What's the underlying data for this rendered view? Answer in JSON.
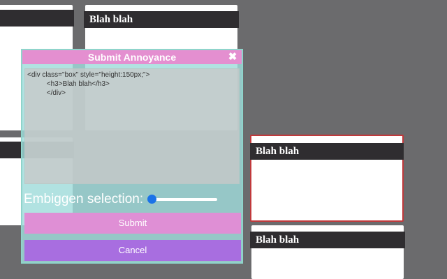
{
  "boxes": [
    {
      "title": ""
    },
    {
      "title": "Blah blah"
    },
    {
      "title": ""
    },
    {
      "title": "Blah blah"
    },
    {
      "title": "Blah blah"
    }
  ],
  "modal": {
    "title": "Submit Annoyance",
    "close_symbol": "✖",
    "code": "<div class=\"box\" style=\"height:150px;\">\n          <h3>Blah blah</h3>\n          </div>",
    "slider_label": "Embiggen selection:",
    "slider_value": 0,
    "submit_label": "Submit",
    "cancel_label": "Cancel"
  },
  "colors": {
    "titlebar": "#e48fd0",
    "submit": "#df8fd5",
    "cancel": "#a86ee0",
    "slider_thumb": "#1a73e8",
    "selected_border": "#c0393b"
  }
}
